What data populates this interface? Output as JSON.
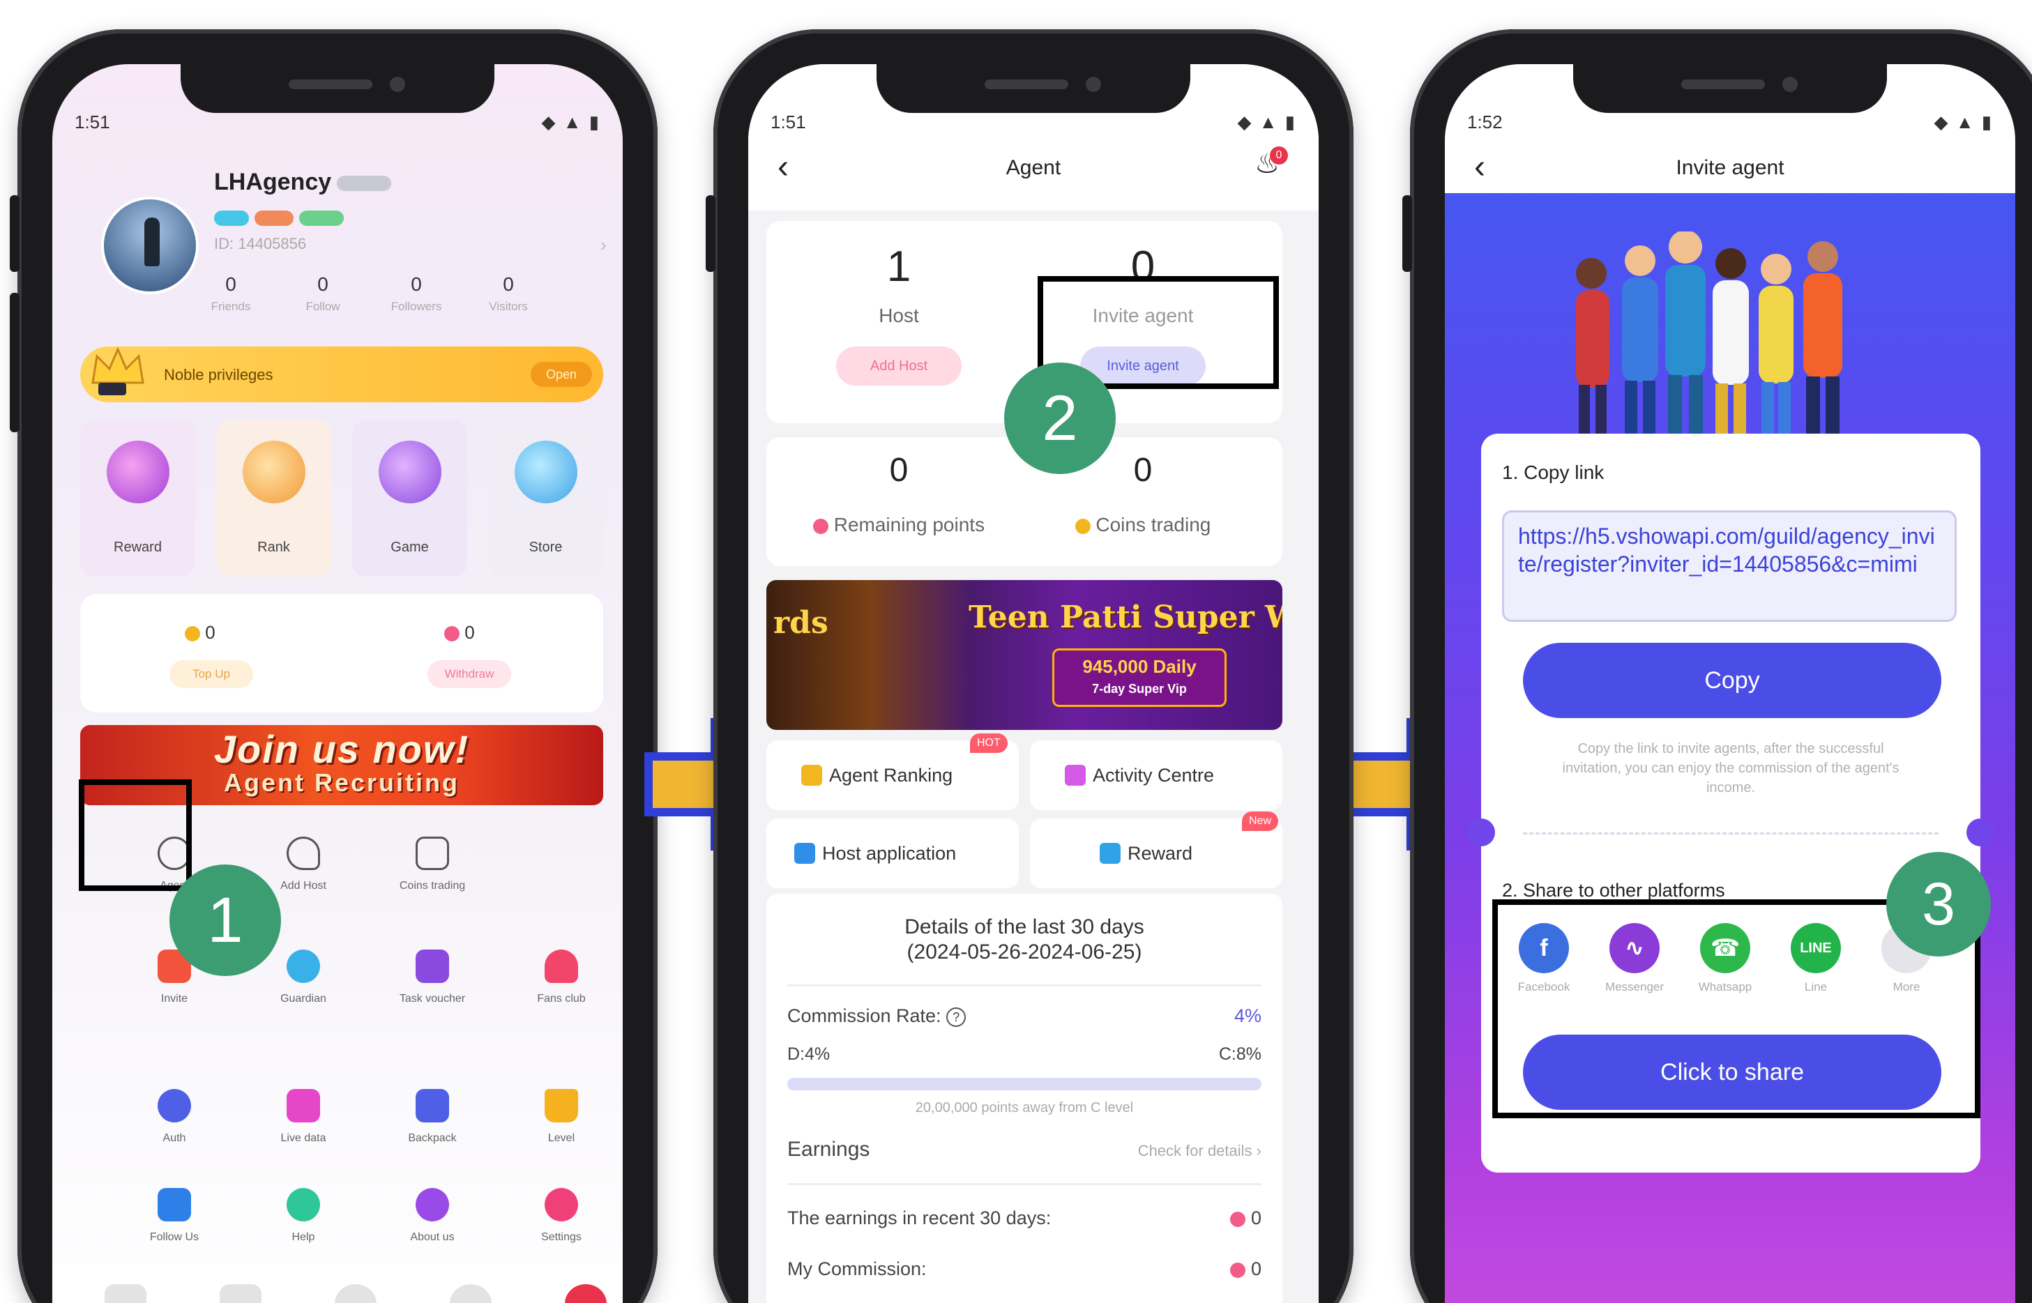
{
  "phone1": {
    "status_time": "1:51",
    "profile": {
      "name": "LHAgency",
      "id_text": "ID: 14405856",
      "stats": [
        {
          "value": "0",
          "label": "Friends"
        },
        {
          "value": "0",
          "label": "Follow"
        },
        {
          "value": "0",
          "label": "Followers"
        },
        {
          "value": "0",
          "label": "Visitors"
        }
      ]
    },
    "noble": {
      "label": "Noble privileges",
      "open": "Open"
    },
    "features": [
      {
        "label": "Reward",
        "icon": "reward-icon"
      },
      {
        "label": "Rank",
        "icon": "rank-icon"
      },
      {
        "label": "Game",
        "icon": "game-icon"
      },
      {
        "label": "Store",
        "icon": "store-icon"
      }
    ],
    "wallet": {
      "coins": "0",
      "topup": "Top Up",
      "points": "0",
      "withdraw": "Withdraw"
    },
    "join_banner": {
      "line1": "Join us now!",
      "line2": "Agent Recruiting"
    },
    "grid": [
      {
        "label": "Agent",
        "icon": "agent-icon"
      },
      {
        "label": "Add Host",
        "icon": "add-host-icon"
      },
      {
        "label": "Coins trading",
        "icon": "coins-trading-icon"
      },
      {
        "label": "Invite",
        "icon": "invite-icon"
      },
      {
        "label": "Guardian",
        "icon": "guardian-icon"
      },
      {
        "label": "Task voucher",
        "icon": "task-voucher-icon"
      },
      {
        "label": "Fans club",
        "icon": "fans-club-icon"
      },
      {
        "label": "Auth",
        "icon": "auth-icon"
      },
      {
        "label": "Live data",
        "icon": "live-data-icon"
      },
      {
        "label": "Backpack",
        "icon": "backpack-icon"
      },
      {
        "label": "Level",
        "icon": "level-icon"
      },
      {
        "label": "Follow Us",
        "icon": "follow-us-icon"
      },
      {
        "label": "Help",
        "icon": "help-icon"
      },
      {
        "label": "About us",
        "icon": "about-us-icon"
      },
      {
        "label": "Settings",
        "icon": "settings-icon"
      }
    ],
    "step": "1"
  },
  "phone2": {
    "status_time": "1:51",
    "title": "Agent",
    "bell_count": "0",
    "host": {
      "count": "1",
      "label": "Host",
      "button": "Add Host"
    },
    "invite": {
      "count": "0",
      "label": "Invite agent",
      "button": "Invite agent"
    },
    "points": {
      "remaining": "0",
      "remaining_label": "Remaining points",
      "coins": "0",
      "coins_label": "Coins trading"
    },
    "banner": {
      "left": "rds",
      "title": "Teen Patti Super Wi",
      "prize": "945,000 Daily",
      "tag": "7-day Super Vip"
    },
    "menu": [
      {
        "label": "Agent Ranking",
        "badge": "HOT"
      },
      {
        "label": "Activity Centre",
        "badge": ""
      },
      {
        "label": "Host application",
        "badge": ""
      },
      {
        "label": "Reward",
        "badge": "New"
      }
    ],
    "details": {
      "title": "Details of the last 30 days",
      "range": "(2024-05-26-2024-06-25)",
      "commission_label": "Commission Rate:",
      "commission_value": "4%",
      "level_left": "D:4%",
      "level_right": "C:8%",
      "progress_fraction": 0.0,
      "away_text": "20,00,000 points away from C level",
      "earnings_label": "Earnings",
      "check_details": "Check for details",
      "recent_label": "The earnings in recent 30 days:",
      "recent_value": "0",
      "my_commission_label": "My Commission:",
      "my_commission_value": "0"
    },
    "step": "2"
  },
  "phone3": {
    "status_time": "1:52",
    "title": "Invite agent",
    "copy_heading": "1.  Copy link",
    "link": "https://h5.vshowapi.com/guild/agency_invite/register?inviter_id=14405856&c=mimi",
    "copy_button": "Copy",
    "hint": "Copy the link to invite agents, after the successful invitation, you can enjoy the commission of the agent's income.",
    "share_heading": "2.  Share to other platforms",
    "share": [
      {
        "label": "Facebook",
        "icon": "facebook-icon",
        "color": "#3b6fe0"
      },
      {
        "label": "Messenger",
        "icon": "messenger-icon",
        "color": "#8a3bd8"
      },
      {
        "label": "Whatsapp",
        "icon": "whatsapp-icon",
        "color": "#2eb84c"
      },
      {
        "label": "Line",
        "icon": "line-icon",
        "color": "#22b34a"
      },
      {
        "label": "More",
        "icon": "more-icon",
        "color": "#dddddd"
      }
    ],
    "share_button": "Click to share",
    "step": "3"
  },
  "colors": {
    "step": "#3c9c72",
    "accent": "#4b4ee6",
    "arrow_fill": "#f0b632",
    "arrow_stroke": "#2f3fd8"
  }
}
